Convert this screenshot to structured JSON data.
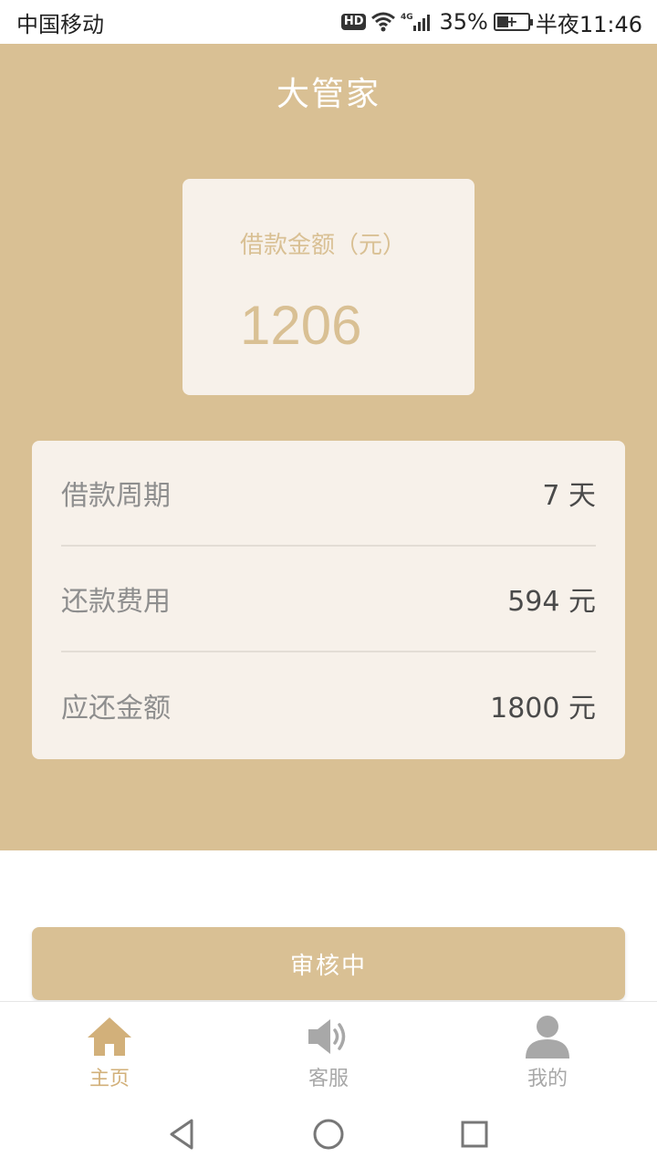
{
  "status_bar": {
    "carrier": "中国移动",
    "hd": "HD",
    "network": "4G",
    "battery": "35%",
    "time": "半夜11:46"
  },
  "header": {
    "title": "大管家"
  },
  "amount_card": {
    "label": "借款金额（元）",
    "value": "1206"
  },
  "details": [
    {
      "label": "借款周期",
      "value": "7 天"
    },
    {
      "label": "还款费用",
      "value": "594 元"
    },
    {
      "label": "应还金额",
      "value": "1800 元"
    }
  ],
  "status_button": {
    "label": "审核中"
  },
  "tabs": [
    {
      "label": "主页",
      "icon": "home-icon",
      "active": true
    },
    {
      "label": "客服",
      "icon": "speaker-icon",
      "active": false
    },
    {
      "label": "我的",
      "icon": "user-icon",
      "active": false
    }
  ],
  "colors": {
    "brand": "#d9c094",
    "card_bg": "#f7f1ea",
    "tab_active": "#d2b07a",
    "tab_inactive": "#a8a8a8"
  }
}
